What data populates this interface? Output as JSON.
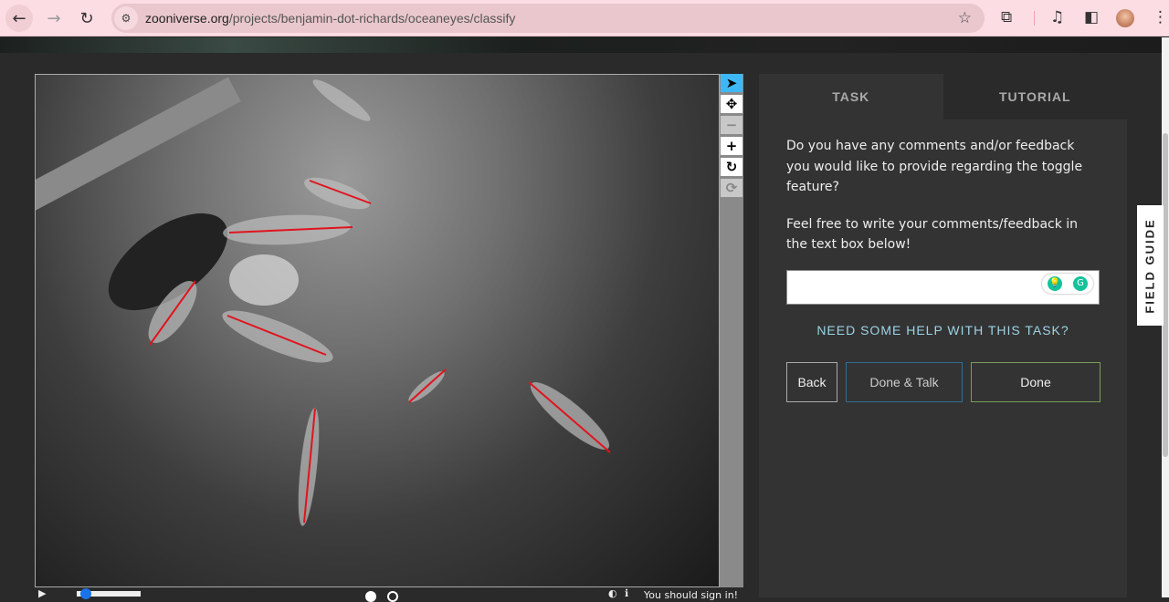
{
  "browser": {
    "url_domain": "zooniverse.org",
    "url_path": "/projects/benjamin-dot-richards/oceaneyes/classify"
  },
  "tools": [
    "pointer-icon",
    "move-icon",
    "zoom-out-icon",
    "zoom-in-icon",
    "rotate-icon",
    "reset-icon"
  ],
  "tabs": {
    "task": "TASK",
    "tutorial": "TUTORIAL"
  },
  "task": {
    "question": "Do you have any comments and/or feedback you would like to provide regarding the toggle feature?",
    "instruction": "Feel free to write your comments/feedback in the text box below!",
    "textarea_value": "",
    "help": "NEED SOME HELP WITH THIS TASK?"
  },
  "buttons": {
    "back": "Back",
    "done_talk": "Done & Talk",
    "done": "Done"
  },
  "field_guide": "FIELD GUIDE",
  "footer": {
    "signin": "You should sign in!"
  },
  "colors": {
    "accent": "#3eb8f5",
    "annotation": "#e0141e",
    "done_talk_border": "#2f6f91",
    "done_border": "#7a9b5a"
  }
}
